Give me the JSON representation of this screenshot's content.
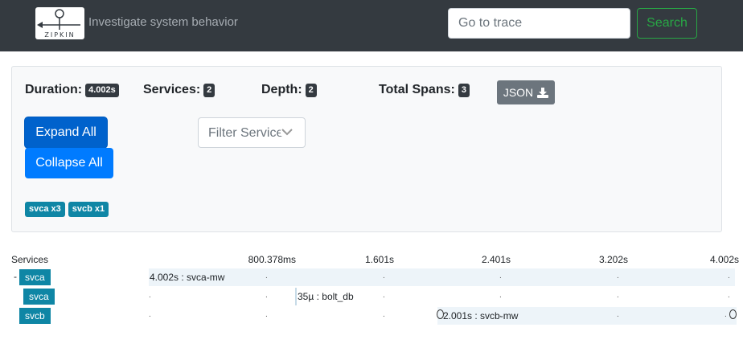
{
  "header": {
    "logo_text": "ZIPKIN",
    "tagline": "Investigate system behavior",
    "trace_input_placeholder": "Go to trace",
    "search_label": "Search"
  },
  "summary": {
    "duration_label": "Duration:",
    "duration_value": "4.002s",
    "services_label": "Services:",
    "services_value": "2",
    "depth_label": "Depth:",
    "depth_value": "2",
    "total_spans_label": "Total Spans:",
    "total_spans_value": "3",
    "json_label": "JSON",
    "expand_all_label": "Expand All",
    "collapse_all_label": "Collapse All",
    "filter_placeholder": "Filter Service",
    "service_badges": [
      "svca x3",
      "svcb x1"
    ]
  },
  "timeline": {
    "services_header": "Services",
    "ticks": [
      "800.378ms",
      "1.601s",
      "2.401s",
      "3.202s",
      "4.002s"
    ],
    "rows": [
      {
        "toggle": "-",
        "service": "svca",
        "label": "4.002s : svca-mw"
      },
      {
        "toggle": "",
        "service": "svca",
        "label": "35µ : bolt_db"
      },
      {
        "toggle": "",
        "service": "svcb",
        "label": "2.001s : svcb-mw"
      }
    ]
  }
}
